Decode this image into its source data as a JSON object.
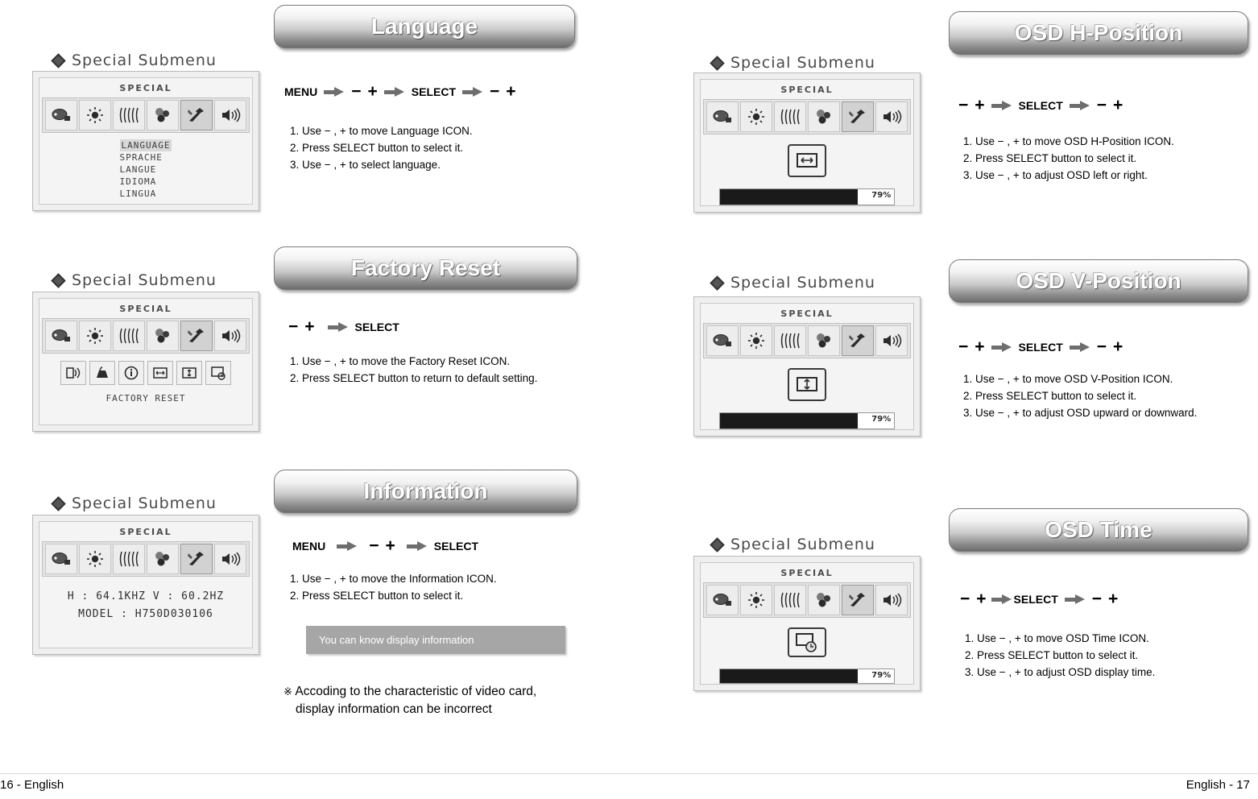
{
  "footer": {
    "left": "16 - English",
    "right": "English - 17"
  },
  "submenu_label": "Special Submenu",
  "sections": [
    {
      "id": "language",
      "title": "Language",
      "osd": {
        "title": "SPECIAL",
        "languages": [
          "LANGUAGE",
          "SPRACHE",
          "LANGUE",
          "IDIOMA",
          "LINGUA"
        ]
      },
      "buttons": [
        "MENU",
        "arrow",
        "minus",
        "plus",
        "arrow",
        "SELECT",
        "arrow",
        "minus",
        "plus"
      ],
      "steps": [
        "1. Use  − , +  to move Language ICON.",
        "2. Press SELECT button to select it.",
        "3. Use  − , +  to select language."
      ]
    },
    {
      "id": "factory-reset",
      "title": "Factory Reset",
      "osd": {
        "title": "SPECIAL",
        "label": "FACTORY RESET"
      },
      "buttons": [
        "minus",
        "plus",
        "arrow",
        "SELECT"
      ],
      "steps": [
        "1. Use  − , +  to move the Factory Reset ICON.",
        "2. Press SELECT button to return to default setting."
      ]
    },
    {
      "id": "information",
      "title": "Information",
      "osd": {
        "title": "SPECIAL",
        "line1": "H : 64.1KHZ   V : 60.2HZ",
        "line2": "MODEL : H750D030106"
      },
      "buttons": [
        "MENU",
        "arrow",
        "minus",
        "plus",
        "arrow",
        "SELECT"
      ],
      "steps": [
        "1. Use  − , +  to move the Information ICON.",
        "2. Press SELECT button to select it."
      ],
      "note": "You can know display information",
      "footnote_mark": "※",
      "footnote_line1": "Accoding to the characteristic of video card,",
      "footnote_line2": "display information can be incorrect"
    },
    {
      "id": "osd-h-position",
      "title": "OSD H-Position",
      "osd": {
        "title": "SPECIAL",
        "percent": "79%",
        "percent_value": 79
      },
      "buttons": [
        "minus",
        "plus",
        "arrow",
        "SELECT",
        "arrow",
        "minus",
        "plus"
      ],
      "steps": [
        "1. Use  − , +  to move OSD H-Position ICON.",
        "2. Press SELECT button to select it.",
        "3. Use  − , +  to adjust OSD left or right."
      ]
    },
    {
      "id": "osd-v-position",
      "title": "OSD V-Position",
      "osd": {
        "title": "SPECIAL",
        "percent": "79%",
        "percent_value": 79
      },
      "buttons": [
        "minus",
        "plus",
        "arrow",
        "SELECT",
        "arrow",
        "minus",
        "plus"
      ],
      "steps": [
        "1. Use  − , +  to move OSD V-Position ICON.",
        "2. Press SELECT button to select it.",
        "3. Use  − , +  to adjust OSD upward or downward."
      ]
    },
    {
      "id": "osd-time",
      "title": "OSD Time",
      "osd": {
        "title": "SPECIAL",
        "percent": "79%",
        "percent_value": 79
      },
      "buttons": [
        "minus",
        "plus",
        "arrow",
        "SELECT",
        "arrow",
        "minus",
        "plus"
      ],
      "steps": [
        "1. Use  − , +  to move OSD Time ICON.",
        "2. Press SELECT button to select it.",
        "3. Use  − , +  to adjust OSD display time."
      ]
    }
  ],
  "symbols": {
    "minus": "−",
    "plus": "+",
    "select": "SELECT",
    "menu": "MENU"
  }
}
